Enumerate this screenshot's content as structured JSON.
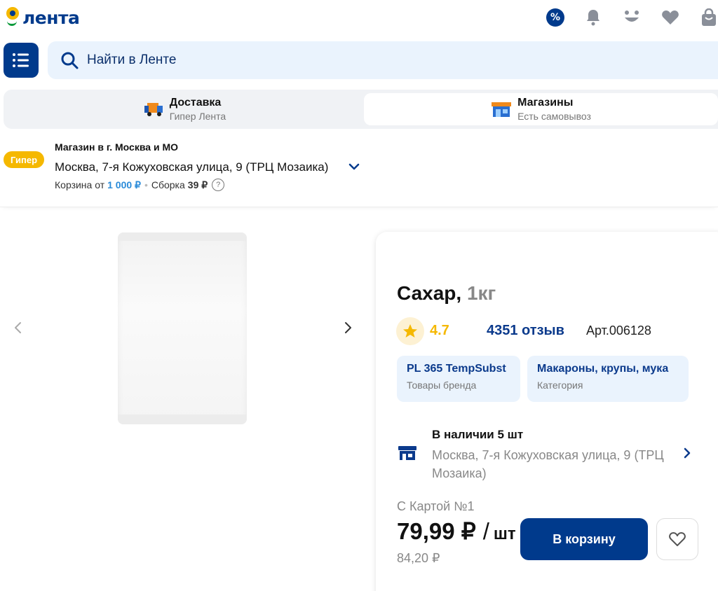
{
  "brand": {
    "name": "лента"
  },
  "header": {
    "icons": [
      "percent-icon",
      "bell-icon",
      "smile-icon",
      "heart-icon",
      "bag-icon"
    ],
    "promo_symbol": "%"
  },
  "search": {
    "placeholder": "Найти в Ленте"
  },
  "modes": {
    "delivery": {
      "title": "Доставка",
      "subtitle": "Гипер Лента"
    },
    "stores": {
      "title": "Магазины",
      "subtitle": "Есть самовывоз"
    }
  },
  "store": {
    "badge": "Гипер",
    "city": "Магазин в г. Москва и МО",
    "address": "Москва, 7-я Кожуховская улица, 9 (ТРЦ Мозаика)",
    "cart_from_label": "Корзина от",
    "cart_from_value": "1 000 ₽",
    "assembly_label": "Сборка",
    "assembly_value": "39 ₽",
    "help": "?"
  },
  "product": {
    "name": "Сахар,",
    "weight": "1кг",
    "rating": "4.7",
    "reviews": "4351 отзыв",
    "article": "Арт.006128",
    "brand_chip": {
      "title": "PL 365 TempSubst",
      "subtitle": "Товары бренда"
    },
    "category_chip": {
      "title": "Макароны, крупы, мука",
      "subtitle": "Категория"
    },
    "stock": {
      "title": "В наличии 5 шт",
      "address": "Москва, 7-я Кожуховская улица, 9 (ТРЦ Мозаика)"
    },
    "card_label": "С Картой №1",
    "price": "79,99 ₽",
    "price_slash": "/",
    "price_unit": "шт",
    "old_price": "84,20 ₽",
    "cart_button": "В корзину"
  },
  "colors": {
    "brand_blue": "#003a8c",
    "brand_yellow": "#f5b800",
    "light_blue": "#eaf3fd"
  }
}
